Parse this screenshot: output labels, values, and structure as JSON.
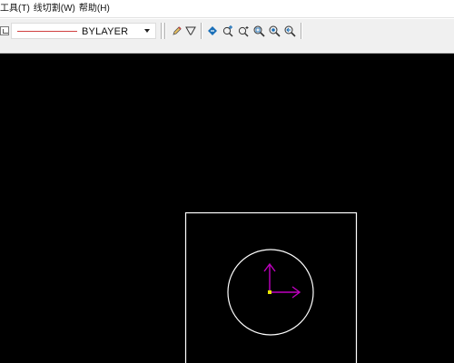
{
  "menu": {
    "items": [
      {
        "label": "工具(T)"
      },
      {
        "label": "线切割(W)"
      },
      {
        "label": "帮助(H)"
      }
    ]
  },
  "toolbar": {
    "linetype": {
      "value": "BYLAYER",
      "sample_color": "#d04040"
    },
    "icons": [
      "layer-icon",
      "pencil-icon",
      "funnel-icon",
      "pan-icon",
      "zoom-realtime-icon",
      "zoom-dynamic-icon",
      "zoom-window-icon",
      "zoom-extents-icon",
      "zoom-previous-icon"
    ]
  },
  "canvas": {
    "background": "#000000",
    "entities": [
      {
        "type": "rectangle",
        "color": "#ffffff"
      },
      {
        "type": "circle",
        "color": "#ffffff"
      },
      {
        "type": "ucs-axis-y",
        "color": "#c000c0"
      },
      {
        "type": "ucs-axis-x",
        "color": "#c000c0"
      },
      {
        "type": "origin-marker",
        "color": "#e8e800"
      }
    ]
  }
}
